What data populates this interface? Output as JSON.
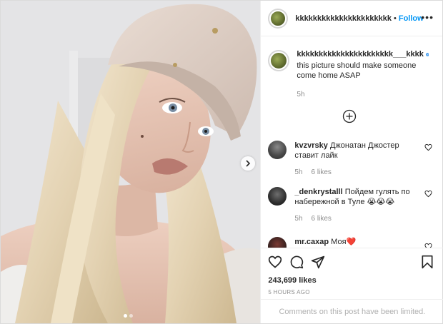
{
  "post": {
    "image_alt": "selfie photo of a woman with long blonde hair wearing a beige cap",
    "carousel": {
      "slides": 2,
      "active_index": 0,
      "next_icon": "chevron-right-icon"
    }
  },
  "header": {
    "username": "kkkkkkkkkkkkkkkkkkkkkk",
    "separator": "•",
    "follow_label": "Follow",
    "more_icon": "more-horizontal-icon"
  },
  "caption": {
    "username": "kkkkkkkkkkkkkkkkkkkkkk___kkkk",
    "verified_icon": "verified-badge-icon",
    "text": "this picture should make someone come home ASAP",
    "time": "5h"
  },
  "load_more_icon": "plus-circle-icon",
  "comments": [
    {
      "username": "kvzvrsky",
      "text": "Джонатан Джостер ставит лайк",
      "time": "5h",
      "likes": "6 likes"
    },
    {
      "username": "_denkrystalll",
      "text": "Пойдем гулять по набережной в Туле 😭😭😭",
      "time": "5h",
      "likes": "6 likes"
    },
    {
      "username": "mr.caxap",
      "text": "Моя❤️",
      "time": "",
      "likes": ""
    }
  ],
  "actions": {
    "like_icon": "heart-icon",
    "comment_icon": "comment-icon",
    "share_icon": "share-icon",
    "save_icon": "bookmark-icon"
  },
  "likes_count": "243,699 likes",
  "date": "5 HOURS AGO",
  "limited_notice": "Comments on this post have been limited.",
  "colors": {
    "link": "#0095f6",
    "verified": "#3897f0",
    "muted": "#8e8e8e",
    "heart": "#ed4956"
  }
}
